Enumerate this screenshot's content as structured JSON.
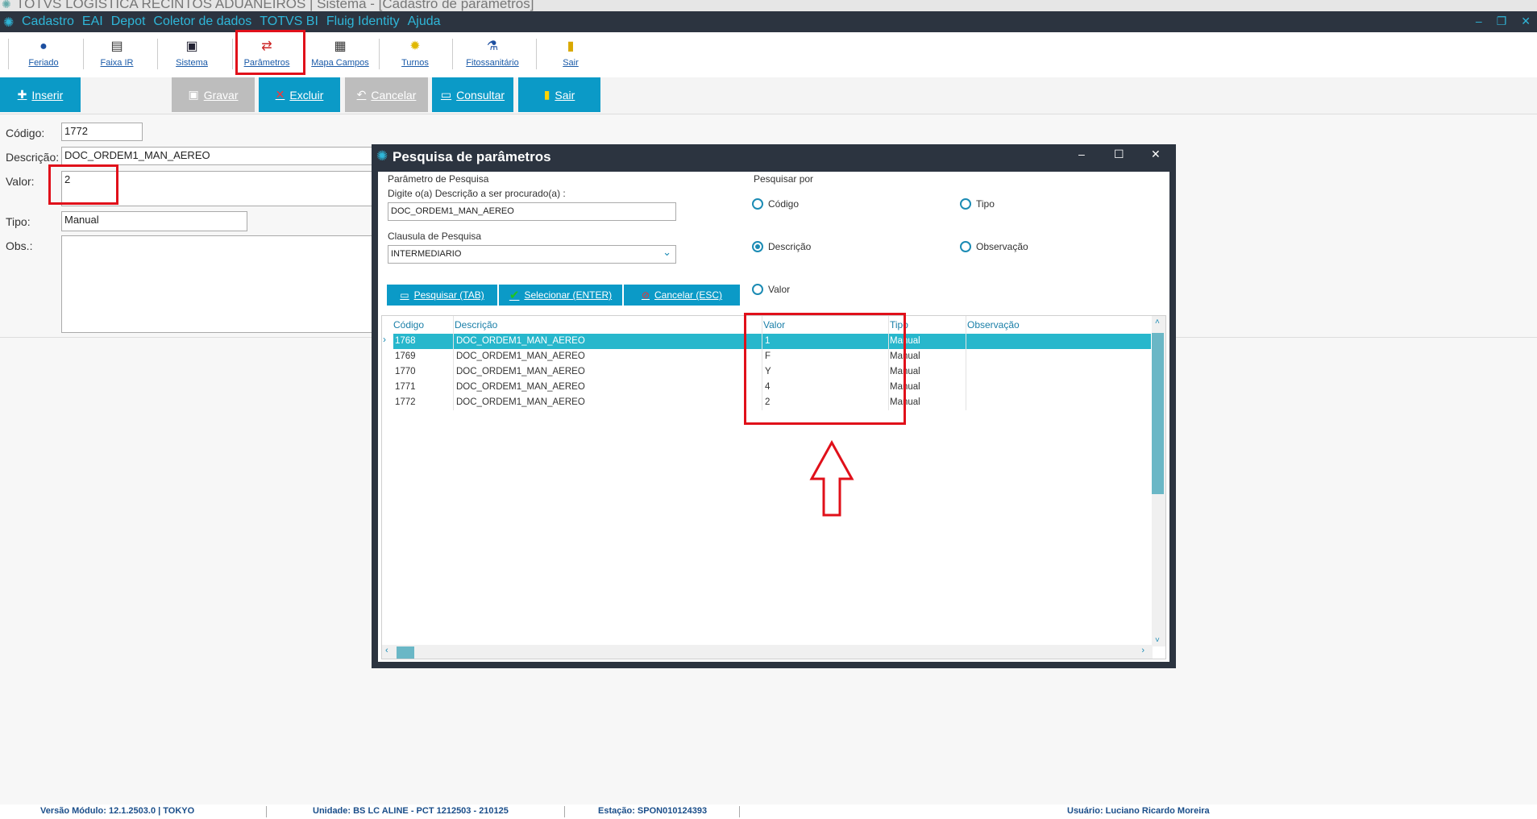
{
  "window": {
    "title": "TOTVS LOGISTICA RECINTOS ADUANEIROS | Sistema - [Cadastro de parâmetros]"
  },
  "menu": {
    "items": [
      "Cadastro",
      "EAI",
      "Depot",
      "Coletor de dados",
      "TOTVS BI",
      "Fluig Identity",
      "Ajuda"
    ]
  },
  "toolbar": {
    "items": [
      {
        "label": "Feriado",
        "icon": "globe-icon"
      },
      {
        "label": "Faixa IR",
        "icon": "document-icon"
      },
      {
        "label": "Sistema",
        "icon": "computer-icon"
      },
      {
        "label": "Parâmetros",
        "icon": "parameters-icon"
      },
      {
        "label": "Mapa Campos",
        "icon": "map-icon"
      },
      {
        "label": "Turnos",
        "icon": "sun-icon"
      },
      {
        "label": "Fitossanitário",
        "icon": "flask-icon"
      },
      {
        "label": "Sair",
        "icon": "exit-door-icon"
      }
    ]
  },
  "actions": {
    "insert": "Inserir",
    "save": "Gravar",
    "delete": "Excluir",
    "cancel": "Cancelar",
    "query": "Consultar",
    "exit": "Sair"
  },
  "form": {
    "codigo_label": "Código:",
    "codigo": "1772",
    "descricao_label": "Descrição:",
    "descricao": "DOC_ORDEM1_MAN_AEREO",
    "valor_label": "Valor:",
    "valor": "2",
    "tipo_label": "Tipo:",
    "tipo": "Manual",
    "obs_label": "Obs.:"
  },
  "dialog": {
    "title": "Pesquisa de parâmetros",
    "param_section": "Parâmetro de Pesquisa",
    "search_prompt": "Digite o(a) Descrição a ser procurado(a) :",
    "search_value": "DOC_ORDEM1_MAN_AEREO",
    "clause_label": "Clausula de Pesquisa",
    "clause_value": "INTERMEDIARIO",
    "search_by_label": "Pesquisar por",
    "radios": {
      "codigo": "Código",
      "tipo": "Tipo",
      "descricao": "Descrição",
      "observacao": "Observação",
      "valor": "Valor"
    },
    "selected_radio": "Descrição",
    "buttons": {
      "search": "Pesquisar (TAB)",
      "select": "Selecionar (ENTER)",
      "cancel": "Cancelar (ESC)"
    },
    "columns": [
      "Código",
      "Descrição",
      "Valor",
      "Tipo",
      "Observação"
    ],
    "rows": [
      {
        "codigo": "1768",
        "descricao": "DOC_ORDEM1_MAN_AEREO",
        "valor": "1",
        "tipo": "Manual",
        "obs": ""
      },
      {
        "codigo": "1769",
        "descricao": "DOC_ORDEM1_MAN_AEREO",
        "valor": "F",
        "tipo": "Manual",
        "obs": ""
      },
      {
        "codigo": "1770",
        "descricao": "DOC_ORDEM1_MAN_AEREO",
        "valor": "Y",
        "tipo": "Manual",
        "obs": ""
      },
      {
        "codigo": "1771",
        "descricao": "DOC_ORDEM1_MAN_AEREO",
        "valor": "4",
        "tipo": "Manual",
        "obs": ""
      },
      {
        "codigo": "1772",
        "descricao": "DOC_ORDEM1_MAN_AEREO",
        "valor": "2",
        "tipo": "Manual",
        "obs": ""
      }
    ],
    "selected_row": 0
  },
  "status": {
    "versao": "Versão Módulo:  12.1.2503.0  |  TOKYO",
    "unidade": "Unidade: BS LC ALINE - PCT 1212503 - 210125",
    "estacao": "Estação: SPON010124393",
    "usuario": "Usuário: Luciano Ricardo Moreira"
  },
  "colors": {
    "accent": "#0b9ac7",
    "menubar": "#2c3440",
    "highlight": "#e0101a",
    "selected_row": "#27b7cc"
  }
}
